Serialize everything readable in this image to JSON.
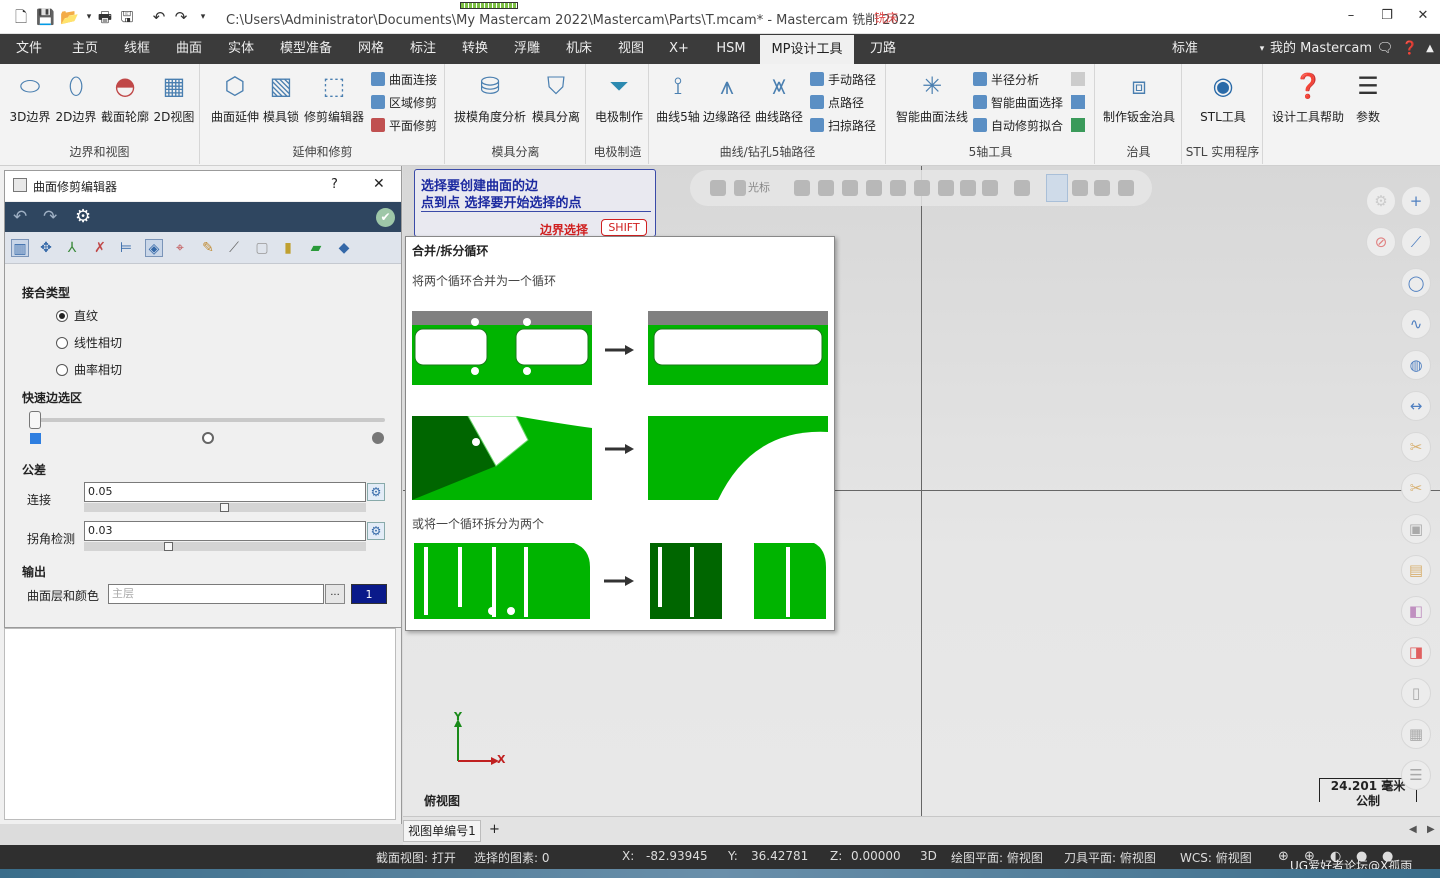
{
  "title": {
    "path": "C:\\Users\\Administrator\\Documents\\My Mastercam 2022\\Mastercam\\Parts\\T.mcam* - Mastercam 铣削 2022",
    "tag": "铣床"
  },
  "menu": {
    "tabs": [
      "文件",
      "主页",
      "线框",
      "曲面",
      "实体",
      "模型准备",
      "网格",
      "标注",
      "转换",
      "浮雕",
      "机床",
      "视图",
      "X+",
      "HSM",
      "MP设计工具",
      "刀路"
    ],
    "active": "MP设计工具",
    "right_label": "标准",
    "account": "我的 Mastercam"
  },
  "ribbon": {
    "groups": [
      {
        "label": "边界和视图",
        "buttons": [
          "3D边界",
          "2D边界",
          "截面轮廓",
          "2D视图"
        ]
      },
      {
        "label": "延伸和修剪",
        "buttons": [
          "曲面延伸",
          "模具锁",
          "修剪编辑器"
        ],
        "small": [
          "曲面连接",
          "区域修剪",
          "平面修剪"
        ]
      },
      {
        "label": "模具分离",
        "buttons": [
          "拔模角度分析",
          "模具分离"
        ]
      },
      {
        "label": "电极制造",
        "buttons": [
          "电极制作"
        ]
      },
      {
        "label": "曲线/钻孔5轴路径",
        "buttons": [
          "曲线5轴",
          "边缘路径",
          "曲线路径"
        ],
        "small": [
          "手动路径",
          "点路径",
          "扫掠路径"
        ]
      },
      {
        "label": "5轴工具",
        "buttons": [
          "智能曲面法线"
        ],
        "small": [
          "半径分析",
          "智能曲面选择",
          "自动修剪拟合"
        ]
      },
      {
        "label": "治具",
        "buttons": [
          "制作钣金治具"
        ]
      },
      {
        "label": "STL 实用程序",
        "buttons": [
          "STL工具"
        ]
      },
      {
        "label": "",
        "buttons": [
          "设计工具帮助",
          "参数"
        ]
      }
    ]
  },
  "dialog": {
    "title": "曲面修剪编辑器",
    "help": "?",
    "close": "✕",
    "joint_type": {
      "label": "接合类型",
      "options": [
        "直纹",
        "线性相切",
        "曲率相切"
      ],
      "selected": "直纹"
    },
    "quick_edge": {
      "label": "快速边选区"
    },
    "tolerance": {
      "label": "公差",
      "connect": {
        "label": "连接",
        "value": "0.05"
      },
      "corner": {
        "label": "拐角检测",
        "value": "0.03"
      }
    },
    "output": {
      "label": "输出",
      "layer_label": "曲面层和颜色",
      "layer_placeholder": "主层",
      "browse": "...",
      "color_value": "1"
    }
  },
  "prompt": {
    "line1": "选择要创建曲面的边",
    "line2": "点到点 选择要开始选择的点",
    "hint": "边界选择",
    "key": "SHIFT"
  },
  "tooltip": {
    "title": "合并/拆分循环",
    "desc1": "将两个循环合并为一个循环",
    "desc2": "或将一个循环拆分为两个"
  },
  "viewtools": {
    "cursor_label": "光标"
  },
  "viewport": {
    "axis_x": "X",
    "axis_y": "Y",
    "view_name": "俯视图",
    "scale_value": "24.201 毫米",
    "scale_unit": "公制"
  },
  "tabs": {
    "sheet": "视图单编号1",
    "add": "+"
  },
  "status": {
    "section_view": "截面视图: 打开",
    "selected": "选择的图素: 0",
    "x_label": "X:",
    "x": "-82.93945",
    "y_label": "Y:",
    "y": "36.42781",
    "z_label": "Z:",
    "z": "0.00000",
    "mode": "3D",
    "plane": "绘图平面: 俯视图",
    "tool_plane": "刀具平面: 俯视图",
    "wcs": "WCS: 俯视图",
    "watermark": "UG爱好者论坛@X孤雨"
  }
}
